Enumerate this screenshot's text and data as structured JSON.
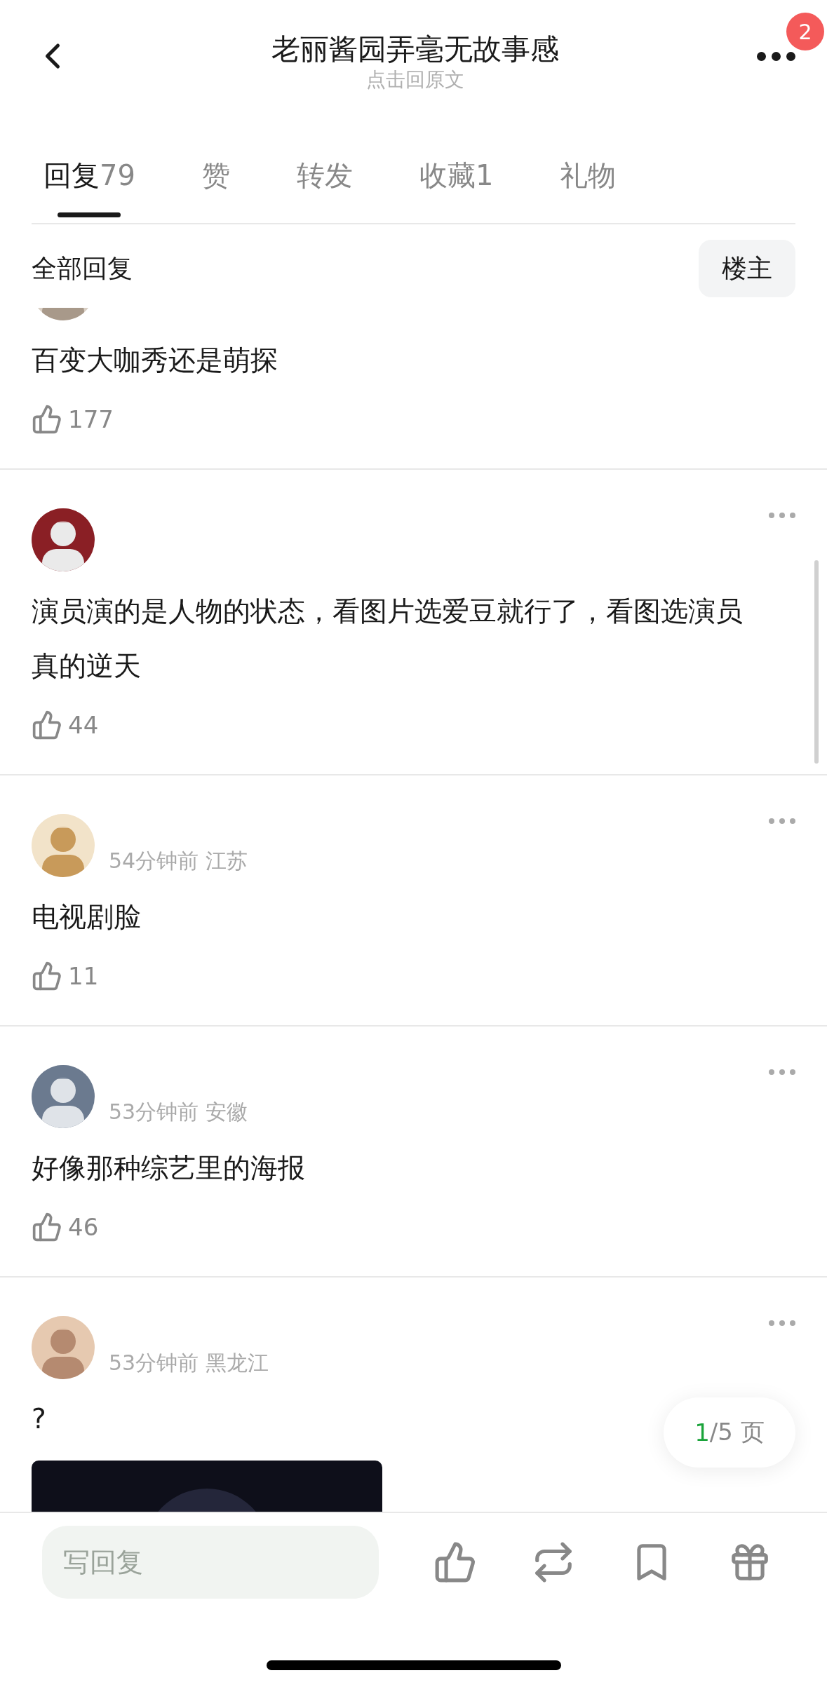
{
  "header": {
    "title": "老丽酱园弄毫无故事感",
    "subtitle": "点击回原文",
    "notification_count": "2"
  },
  "tabs": [
    {
      "label": "回复",
      "count": "79",
      "selected": true
    },
    {
      "label": "赞",
      "selected": false
    },
    {
      "label": "转发",
      "selected": false
    },
    {
      "label": "收藏",
      "count": "1",
      "selected": false
    },
    {
      "label": "礼物",
      "selected": false
    }
  ],
  "filter": {
    "label": "全部回复",
    "button": "楼主"
  },
  "comments": [
    {
      "text": "百变大咖秀还是萌探",
      "likes": "177"
    },
    {
      "text": "演员演的是人物的状态，看图片选爱豆就行了，看图选演员真的逆天",
      "likes": "44"
    },
    {
      "time": "54分钟前 江苏",
      "text": "电视剧脸",
      "likes": "11"
    },
    {
      "time": "53分钟前 安徽",
      "text": "好像那种综艺里的海报",
      "likes": "46"
    },
    {
      "time": "53分钟前 黑龙江",
      "text": "?"
    }
  ],
  "pager": {
    "current": "1",
    "rest": "/5 页"
  },
  "reply_bar": {
    "placeholder": "写回复"
  }
}
